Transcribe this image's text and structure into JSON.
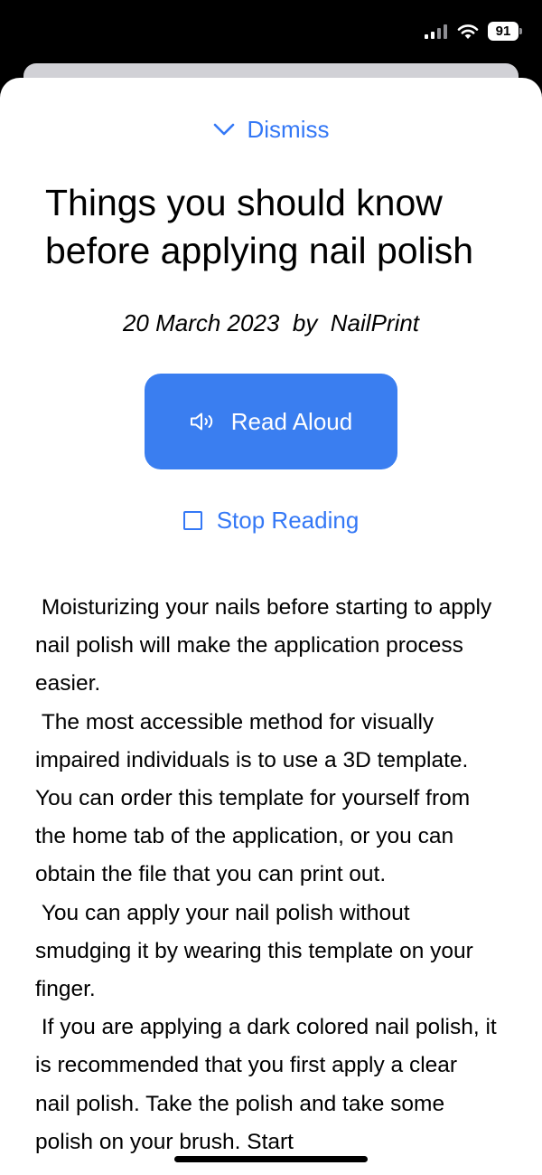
{
  "status_bar": {
    "battery_level": "91",
    "signal_icon": "cellular-signal-icon",
    "wifi_icon": "wifi-icon"
  },
  "dismiss": {
    "label": "Dismiss",
    "icon": "chevron-down-icon"
  },
  "article": {
    "title": "Things you should know before applying nail polish",
    "date": "20 March 2023",
    "by": "by",
    "author": "NailPrint",
    "paragraphs": [
      " Moisturizing your nails before starting to apply nail polish will make the application process easier.",
      " The most accessible method for visually impaired individuals is to use a 3D template. You can order this template for yourself from the home tab of the application, or you can obtain the file that you can print out.",
      " You can apply your nail polish without smudging it by wearing this template on your finger.",
      " If you are applying a dark colored nail polish, it is recommended that you first apply a clear nail polish. Take the polish and take some polish on your brush. Start"
    ]
  },
  "actions": {
    "read_aloud_label": "Read Aloud",
    "read_aloud_icon": "speaker-icon",
    "stop_reading_label": "Stop Reading",
    "stop_reading_icon": "stop-square-icon"
  },
  "colors": {
    "accent": "#3478f6",
    "button_fill": "#3a7ef0",
    "text": "#000000",
    "sheet_background": "#ffffff"
  }
}
